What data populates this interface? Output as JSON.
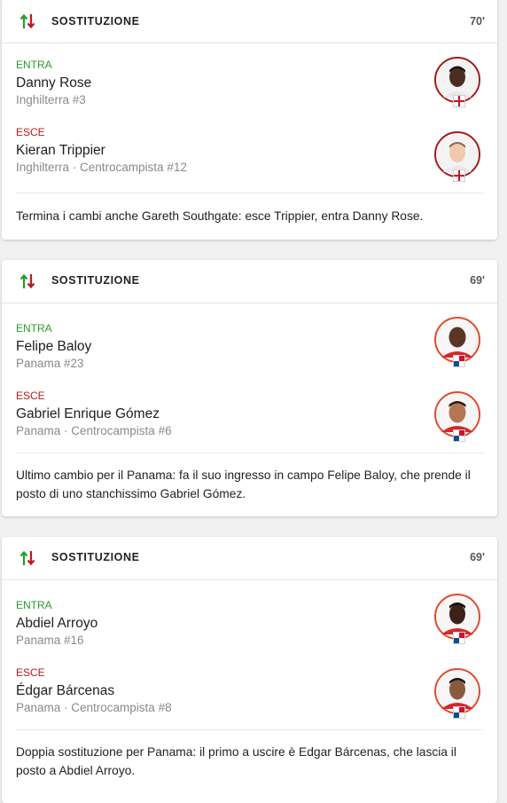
{
  "colors": {
    "entra": "#2a9a2a",
    "esce": "#c0171c",
    "england_ring": "#a5191f",
    "panama_ring": "#e24a2c"
  },
  "cards": [
    {
      "title": "SOSTITUZIONE",
      "minute": "70'",
      "in": {
        "role": "ENTRA",
        "name": "Danny Rose",
        "detail": "Inghilterra #3",
        "flag": "england-flag-icon"
      },
      "out": {
        "role": "ESCE",
        "name": "Kieran Trippier",
        "detail": "Inghilterra · Centrocampista #12",
        "flag": "england-flag-icon"
      },
      "comment": "Termina i cambi anche Gareth Southgate: esce Trippier, entra Danny Rose."
    },
    {
      "title": "SOSTITUZIONE",
      "minute": "69'",
      "in": {
        "role": "ENTRA",
        "name": "Felipe Baloy",
        "detail": "Panama #23",
        "flag": "panama-flag-icon"
      },
      "out": {
        "role": "ESCE",
        "name": "Gabriel Enrique Gómez",
        "detail": "Panama · Centrocampista #6",
        "flag": "panama-flag-icon"
      },
      "comment": "Ultimo cambio per il Panama: fa il suo ingresso in campo Felipe Baloy, che prende il posto di uno stanchissimo Gabriel Gómez."
    },
    {
      "title": "SOSTITUZIONE",
      "minute": "69'",
      "in": {
        "role": "ENTRA",
        "name": "Abdiel Arroyo",
        "detail": "Panama #16",
        "flag": "panama-flag-icon"
      },
      "out": {
        "role": "ESCE",
        "name": "Édgar Bárcenas",
        "detail": "Panama · Centrocampista #8",
        "flag": "panama-flag-icon"
      },
      "comment": "Doppia sostituzione per Panama: il primo a uscire è Edgar Bárcenas, che lascia il posto a Abdiel Arroyo."
    }
  ]
}
